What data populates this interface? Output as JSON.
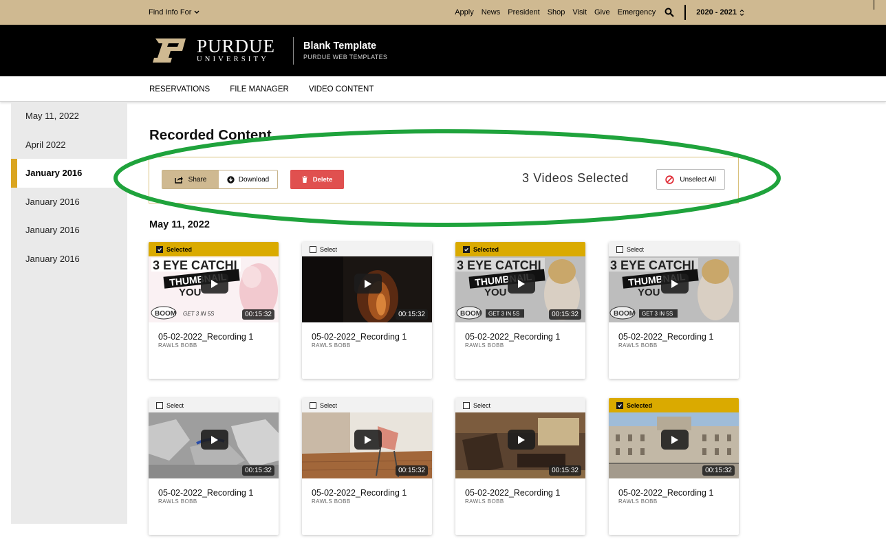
{
  "utility": {
    "find_info": "Find Info For",
    "links": [
      "Apply",
      "News",
      "President",
      "Shop",
      "Visit",
      "Give",
      "Emergency"
    ],
    "year": "2020 - 2021"
  },
  "header": {
    "logo_word": "PURDUE",
    "logo_sub": "UNIVERSITY",
    "site_title": "Blank Template",
    "site_subtitle": "PURDUE WEB TEMPLATES"
  },
  "nav": [
    "RESERVATIONS",
    "FILE MANAGER",
    "VIDEO CONTENT"
  ],
  "sidebar": {
    "items": [
      "May 11, 2022",
      "April 2022",
      "January 2016",
      "January 2016",
      "January 2016",
      "January 2016"
    ],
    "active_index": 2
  },
  "main": {
    "title": "Recorded Content",
    "toolbar": {
      "share": "Share",
      "download": "Download",
      "delete": "Delete",
      "selected_count": "3 Videos Selected",
      "unselect_all": "Unselect All"
    },
    "section_heading": "May 11, 2022",
    "videos": [
      {
        "selected": true,
        "status": "Selected",
        "duration": "00:15:32",
        "title": "05-02-2022_Recording 1",
        "owner": "RAWLS BOBB",
        "thumb": "thumbnail-pink"
      },
      {
        "selected": false,
        "status": "Select",
        "duration": "00:15:32",
        "title": "05-02-2022_Recording 1",
        "owner": "RAWLS BOBB",
        "thumb": "dark-fire"
      },
      {
        "selected": true,
        "status": "Selected",
        "duration": "00:15:32",
        "title": "05-02-2022_Recording 1",
        "owner": "RAWLS BOBB",
        "thumb": "thumbnail-gray"
      },
      {
        "selected": false,
        "status": "Select",
        "duration": "00:15:32",
        "title": "05-02-2022_Recording 1",
        "owner": "RAWLS BOBB",
        "thumb": "thumbnail-gray"
      },
      {
        "selected": false,
        "status": "Select",
        "duration": "00:15:32",
        "title": "05-02-2022_Recording 1",
        "owner": "RAWLS BOBB",
        "thumb": "render-3d"
      },
      {
        "selected": false,
        "status": "Select",
        "duration": "00:15:32",
        "title": "05-02-2022_Recording 1",
        "owner": "RAWLS BOBB",
        "thumb": "room-chair"
      },
      {
        "selected": false,
        "status": "Select",
        "duration": "00:15:32",
        "title": "05-02-2022_Recording 1",
        "owner": "RAWLS BOBB",
        "thumb": "hall-interior"
      },
      {
        "selected": true,
        "status": "Selected",
        "duration": "00:15:32",
        "title": "05-02-2022_Recording 1",
        "owner": "RAWLS BOBB",
        "thumb": "palace"
      }
    ]
  },
  "colors": {
    "gold": "#cfb991",
    "accent": "#daaa00",
    "delete": "#e0504f",
    "highlight": "#1fa33c"
  }
}
